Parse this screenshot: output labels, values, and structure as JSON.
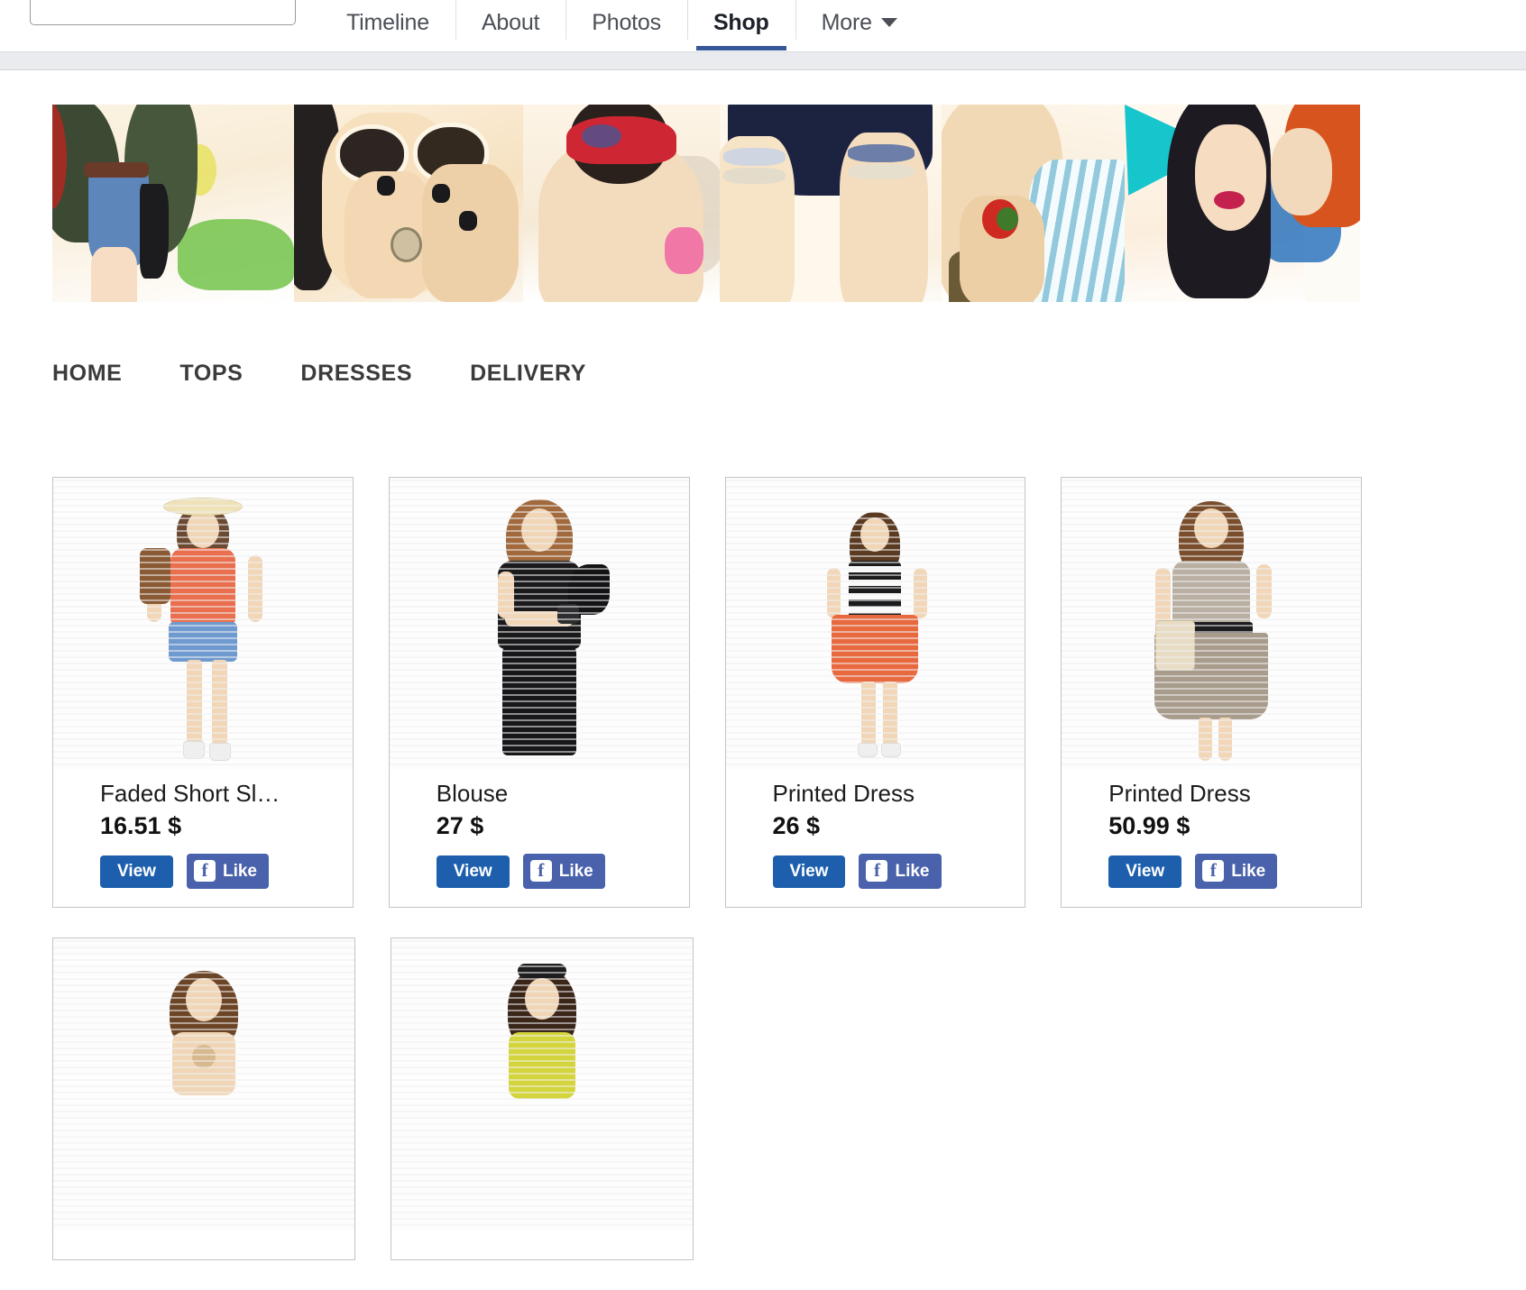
{
  "page_tabs": [
    {
      "label": "Timeline",
      "active": false
    },
    {
      "label": "About",
      "active": false
    },
    {
      "label": "Photos",
      "active": false
    },
    {
      "label": "Shop",
      "active": true
    },
    {
      "label": "More",
      "active": false,
      "has_caret": true
    }
  ],
  "cover": {
    "alt": "fashion collage cover photo"
  },
  "shop_nav": [
    {
      "label": "HOME"
    },
    {
      "label": "TOPS"
    },
    {
      "label": "DRESSES"
    },
    {
      "label": "DELIVERY"
    }
  ],
  "buttons": {
    "view_label": "View",
    "like_label": "Like",
    "facebook_glyph": "f"
  },
  "colors": {
    "tab_active_underline": "#365899",
    "view_button": "#1d5fad",
    "like_button": "#4a62ab",
    "grey_strip": "#e9ebee",
    "card_border": "#c4c4c4",
    "shop_nav_text": "#3b3b3b"
  },
  "products": [
    {
      "title": "Faded Short Sl…",
      "price": "16.51 $"
    },
    {
      "title": "Blouse",
      "price": "27 $"
    },
    {
      "title": "Printed Dress",
      "price": "26 $"
    },
    {
      "title": "Printed Dress",
      "price": "50.99 $"
    }
  ],
  "products_row2": [
    {
      "title": "",
      "price": ""
    },
    {
      "title": "",
      "price": ""
    }
  ]
}
